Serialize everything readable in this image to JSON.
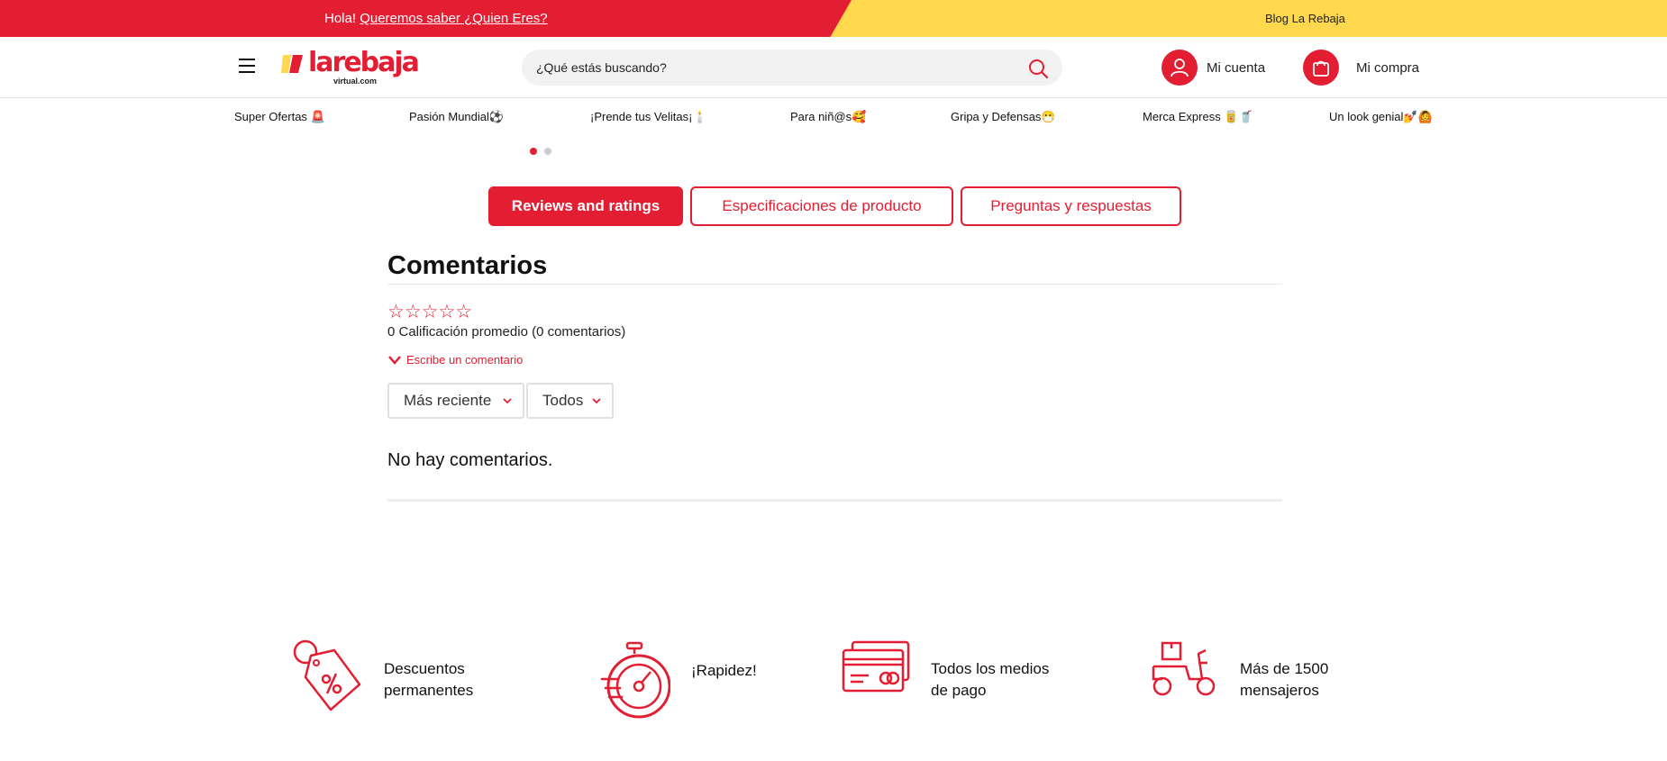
{
  "topbar": {
    "greeting": "Hola!",
    "promo_link": "Queremos saber ¿Quien Eres?",
    "blog_link": "Blog La Rebaja",
    "red": "#e31e32",
    "yellow": "#ffd84d"
  },
  "header": {
    "logo_word": "larebaja",
    "logo_sub": "virtual.com",
    "search_placeholder": "¿Qué estás buscando?",
    "account_label": "Mi cuenta",
    "cart_label": "Mi compra",
    "icons": [
      "menu-icon",
      "search-icon",
      "user-icon",
      "bag-icon"
    ]
  },
  "categories": [
    {
      "label": "Super Ofertas 🚨"
    },
    {
      "label": "Pasión Mundial⚽"
    },
    {
      "label": "¡Prende tus Velitas¡🕯️"
    },
    {
      "label": "Para niñ@s🥰"
    },
    {
      "label": "Gripa y Defensas😷"
    },
    {
      "label": "Merca Express 🥫🥤"
    },
    {
      "label": "Un look genial💅🙆"
    }
  ],
  "carousel": {
    "active_index": 0,
    "count": 2
  },
  "tabs": [
    {
      "label": "Reviews and ratings",
      "active": true
    },
    {
      "label": "Especificaciones de producto",
      "active": false
    },
    {
      "label": "Preguntas y respuestas",
      "active": false
    }
  ],
  "comments": {
    "title": "Comentarios",
    "stars": "☆☆☆☆☆",
    "rating_summary": "0 Calificación promedio (0 comentarios)",
    "write_link": "Escribe un comentario",
    "sort_select": "Más reciente",
    "filter_select": "Todos",
    "empty_message": "No hay comentarios."
  },
  "features": [
    {
      "line1": "Descuentos",
      "line2": "permanentes",
      "icon": "discount-tag-icon"
    },
    {
      "line1": "¡Rapidez!",
      "line2": "",
      "icon": "stopwatch-icon"
    },
    {
      "line1": "Todos los medios",
      "line2": "de pago",
      "icon": "credit-card-icon"
    },
    {
      "line1": "Más de 1500",
      "line2": "mensajeros",
      "icon": "delivery-scooter-icon"
    }
  ]
}
